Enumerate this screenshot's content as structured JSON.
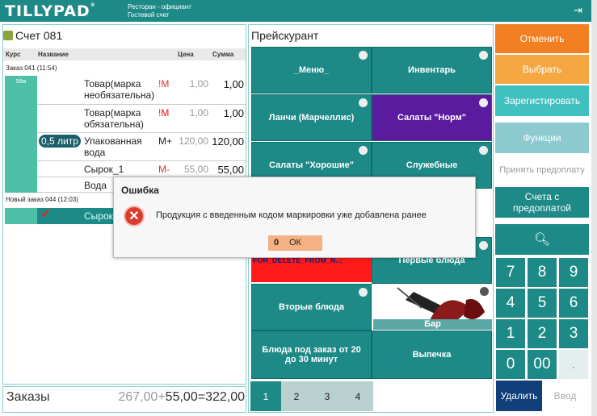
{
  "app": {
    "logo": "TILLYPAD",
    "trademark": "®",
    "line1": "Ресторан - официант",
    "line2": "Гостевой счет"
  },
  "account": {
    "title": "Счет 081"
  },
  "table_header": {
    "course": "Курс",
    "name": "Название",
    "price": "Цена",
    "sum": "Сумма"
  },
  "order1": {
    "label": "Заказ 041 (11:54)",
    "course_time": "58м"
  },
  "rows": [
    {
      "volume": "",
      "name": "Товар(марка необязательна)",
      "mark": "!M",
      "price": "1,00",
      "sum": "1,00"
    },
    {
      "volume": "",
      "name": "Товар(марка обязательна)",
      "mark": "!M",
      "price": "1,00",
      "sum": "1,00"
    },
    {
      "volume": "0,5 литр",
      "name": "Упакованная вода",
      "mark": "M+",
      "price": "120,00",
      "sum": "120,00"
    },
    {
      "volume": "",
      "name": "Сырок_1",
      "mark": "M-",
      "price": "55,00",
      "sum": "55,00"
    },
    {
      "volume": "",
      "name": "Вода",
      "mark": "",
      "price": "",
      "sum": ""
    }
  ],
  "order2": {
    "label": "Новый заказ 044 (12:03)",
    "selected_item": "Сырок"
  },
  "footer": {
    "orders_label": "Заказы",
    "amount1": "267,00",
    "plus": "+",
    "amount2": "55,00",
    "equals": "=",
    "total": "322,00"
  },
  "pricelist": {
    "title": "Прейскурант",
    "tiles": [
      "_Меню_",
      "Инвентарь",
      "Ланчи (Марчеллис)",
      "Салаты \"Норм\"",
      "Салаты \"Хорошие\"",
      "Служебные",
      "FOR_DELETE_FROM_N...",
      "Первые блюда",
      "Вторые блюда",
      "Бар",
      "Блюда под заказ от 20 до 30 минут",
      "Выпечка"
    ],
    "pages": [
      "1",
      "2",
      "3",
      "4"
    ]
  },
  "actions": {
    "cancel": "Отменить",
    "select": "Выбрать",
    "register": "Зарегистировать",
    "functions": "Функции",
    "prepay": "Принять предоплату",
    "prepaid": "Счета с предоплатой",
    "delete": "Удалить",
    "enter": "Ввод"
  },
  "keypad": [
    "7",
    "8",
    "9",
    "4",
    "5",
    "6",
    "1",
    "2",
    "3",
    "0",
    "00",
    "."
  ],
  "dialog": {
    "title": "Ошибка",
    "message": "Продукция с введенным кодом маркировки уже добавлена ранее",
    "ok_key": "0",
    "ok_label": "ОК"
  },
  "icons": {
    "logout": "logout-icon",
    "search": "search-icon",
    "error": "error-icon",
    "folder": "folder-icon"
  },
  "colors": {
    "teal": "#1d8a87",
    "orange": "#f27f22",
    "purple": "#5b1b9e",
    "red": "#ff1a1a"
  }
}
